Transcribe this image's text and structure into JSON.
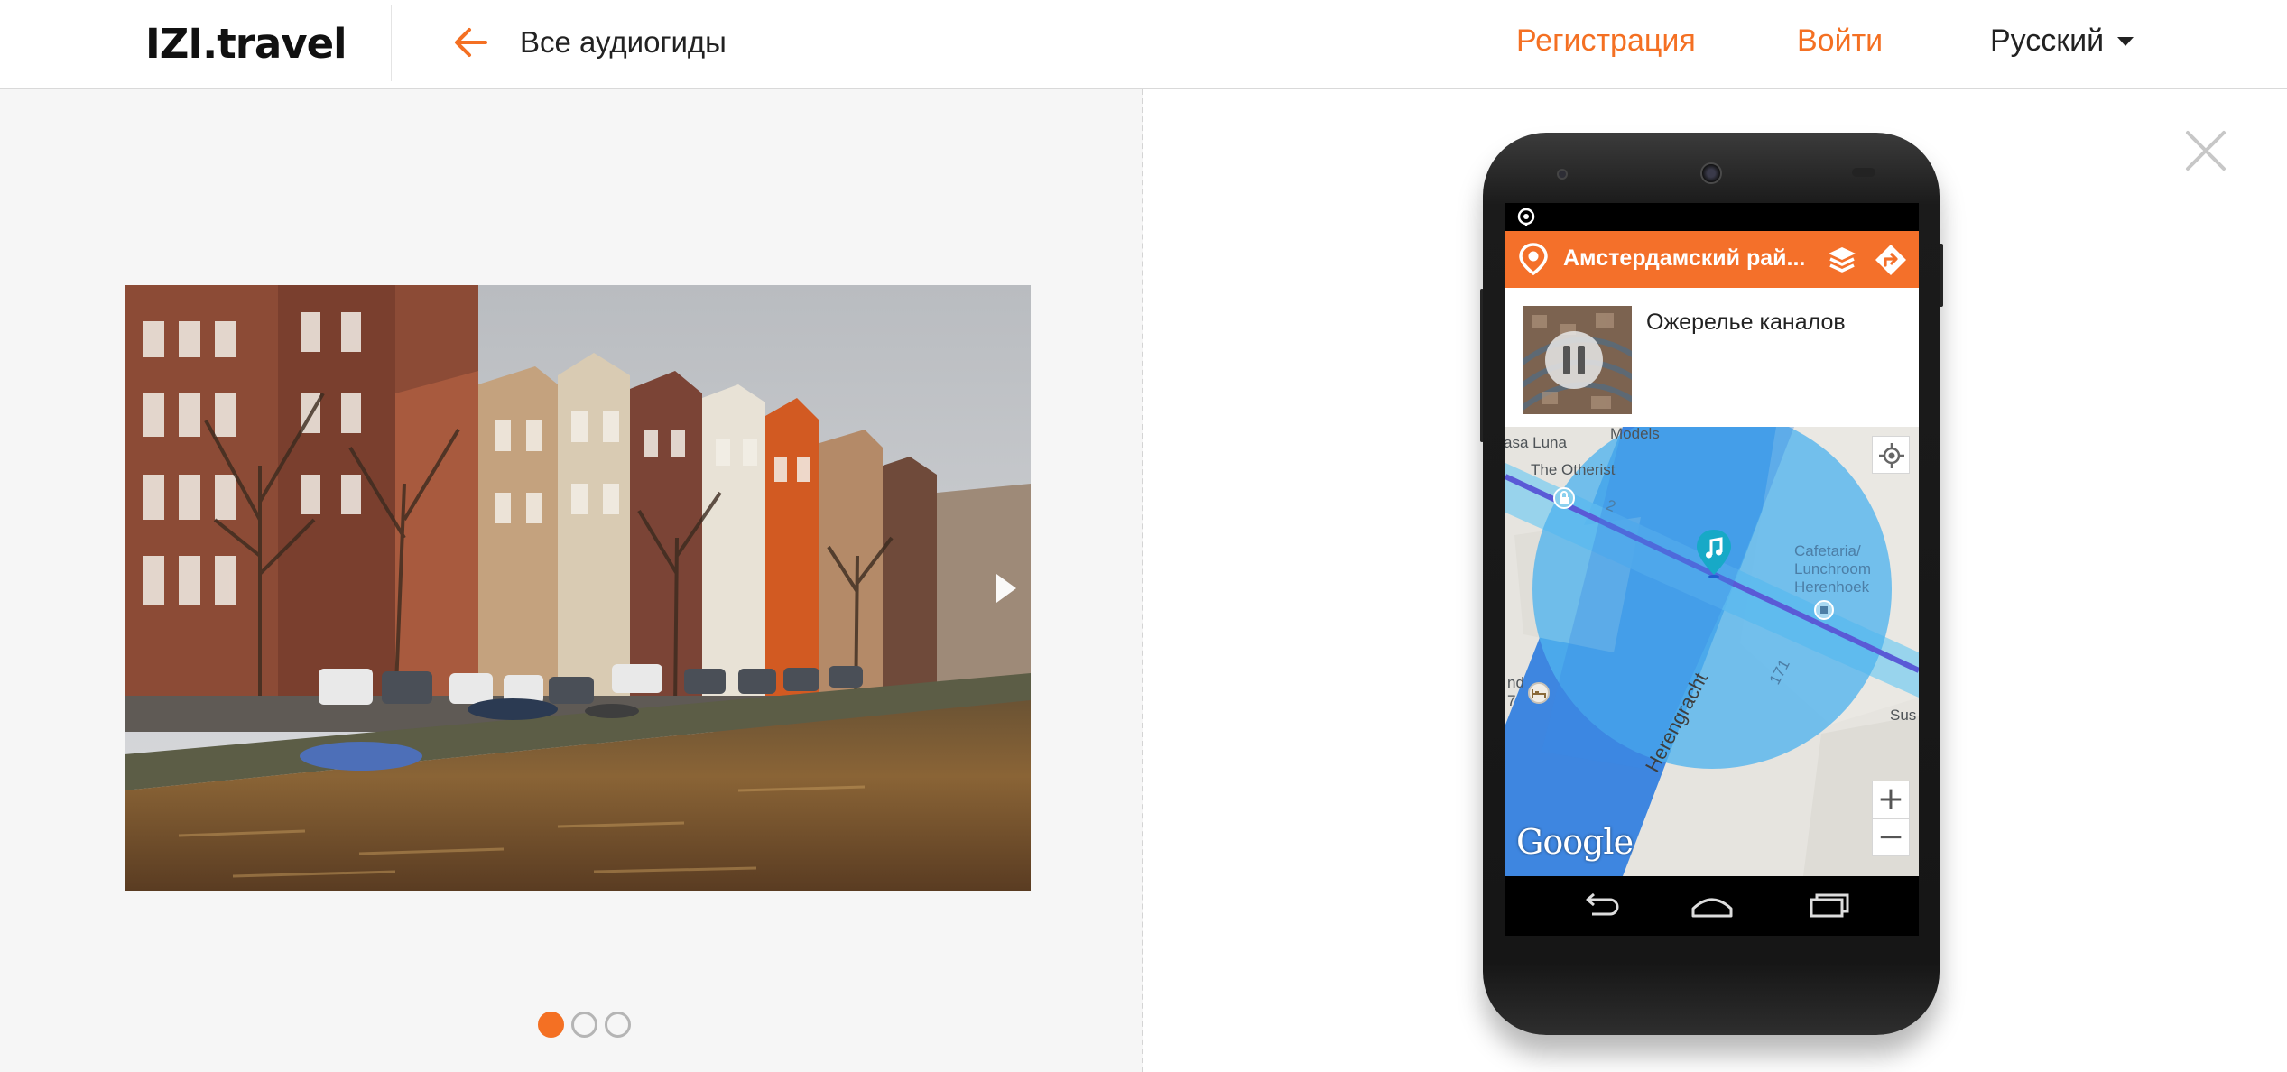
{
  "header": {
    "logo": "IZI.travel",
    "back_label": "Все аудиогиды",
    "register": "Регистрация",
    "login": "Войти",
    "language": "Русский"
  },
  "slider": {
    "slide_count": 3,
    "active_index": 0
  },
  "phone_app": {
    "title": "Амстердамский рай...",
    "track_title": "Ожерелье каналов",
    "map_labels": {
      "casa_luna": "asa Luna",
      "models": "Models",
      "the_otherist": "The Otherist",
      "number_2": "2",
      "cafe_1": "Cafetaria/",
      "cafe_2": "Lunchroom",
      "cafe_3": "Herenhoek",
      "number_171": "171",
      "side_d": "nd",
      "side_7": "7",
      "sus": "Sus",
      "street": "Herengracht",
      "google": "Google"
    },
    "zoom_in": "+",
    "zoom_out": "−"
  },
  "colors": {
    "accent": "#f47023",
    "app_bar": "#f4702a",
    "geofence": "#4fb4ee",
    "canal": "#3e86e0"
  },
  "icons": [
    "arrow-left-icon",
    "caret-down-icon",
    "chevron-right-icon",
    "close-icon",
    "izi-logo-icon",
    "layers-icon",
    "route-icon",
    "pause-icon",
    "locate-icon",
    "music-pin-icon",
    "back-icon",
    "home-icon",
    "recents-icon"
  ]
}
